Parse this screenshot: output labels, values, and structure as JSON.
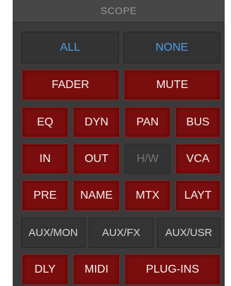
{
  "header": {
    "title": "SCOPE"
  },
  "select": {
    "all": "ALL",
    "none": "NONE"
  },
  "row_fader_mute": {
    "fader": "FADER",
    "mute": "MUTE"
  },
  "row_processing": {
    "eq": "EQ",
    "dyn": "DYN",
    "pan": "PAN",
    "bus": "BUS"
  },
  "row_io": {
    "in": "IN",
    "out": "OUT",
    "hw": "H/W",
    "vca": "VCA"
  },
  "row_misc": {
    "pre": "PRE",
    "name": "NAME",
    "mtx": "MTX",
    "layt": "LAYT"
  },
  "row_aux": {
    "aux_mon": "AUX/MON",
    "aux_fx": "AUX/FX",
    "aux_usr": "AUX/USR"
  },
  "row_last": {
    "dly": "DLY",
    "midi": "MIDI",
    "plugins": "PLUG-INS"
  },
  "colors": {
    "active_red": "#7a0e0e",
    "select_blue": "#4b9fe6",
    "panel": "#3a3a3a",
    "inactive_text": "#777777"
  }
}
